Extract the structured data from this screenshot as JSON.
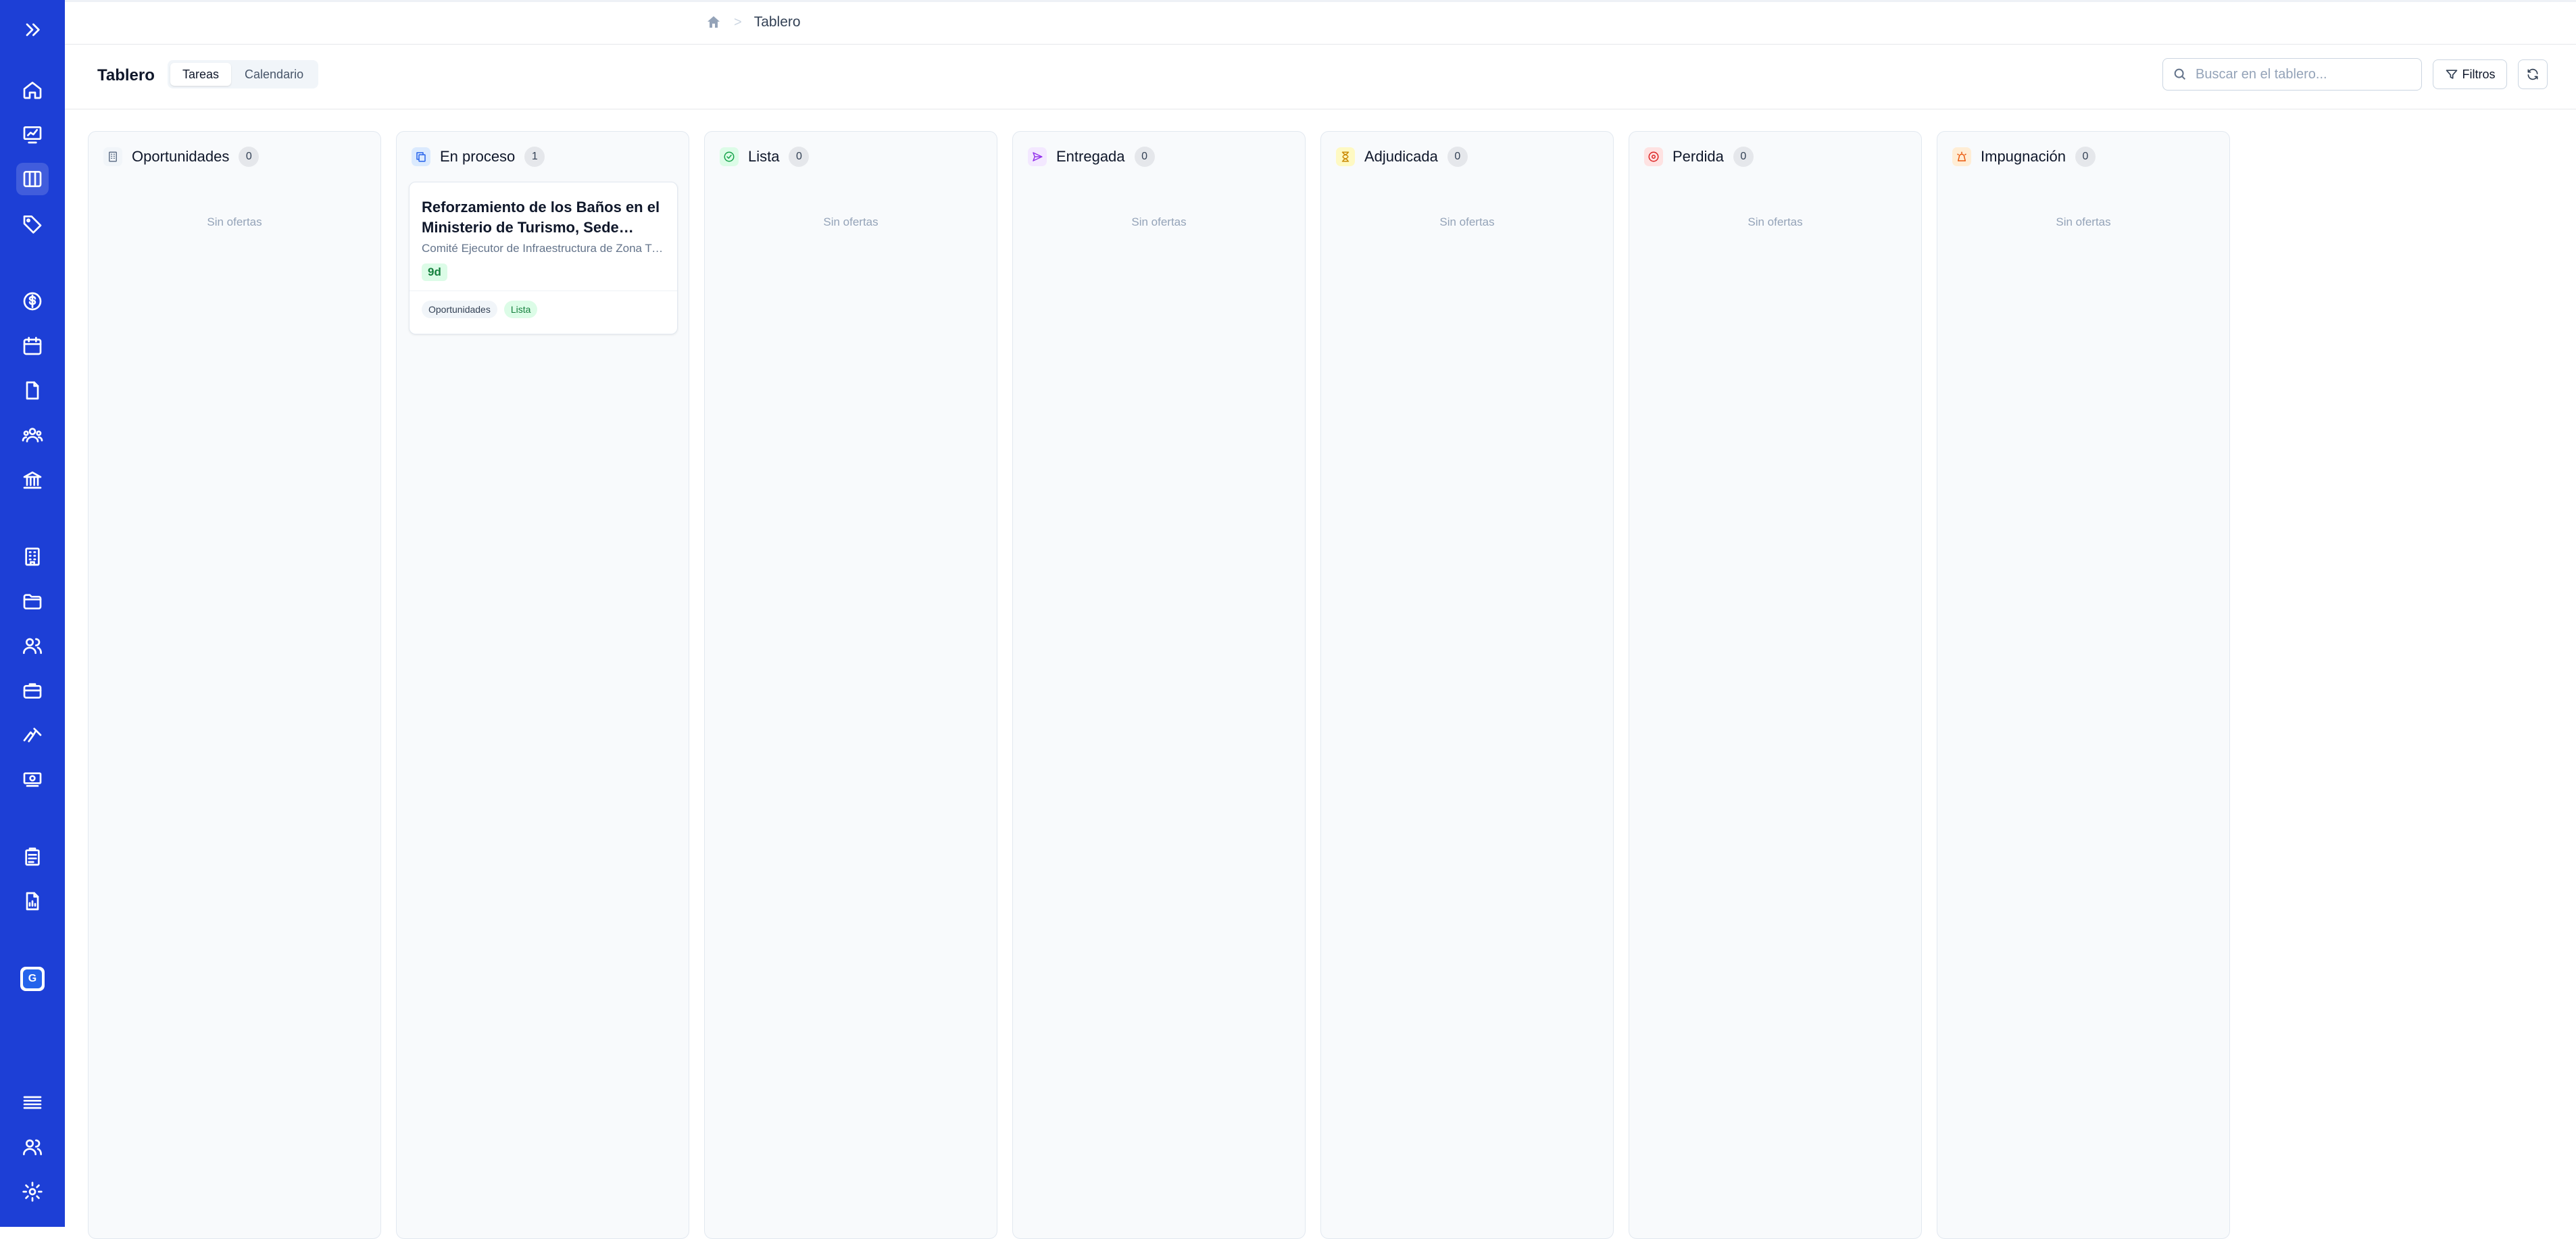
{
  "breadcrumb": {
    "home_icon": "home-icon",
    "current": "Tablero"
  },
  "header": {
    "title": "Tablero",
    "views": [
      "Tareas",
      "Calendario"
    ],
    "selected_view": "Tareas",
    "search_placeholder": "Buscar en el tablero...",
    "filter_label": "Filtros"
  },
  "sidebar": {
    "items": [
      "expand-icon",
      "home-icon",
      "dashboard-icon",
      "board-icon",
      "tag-icon",
      "dollar-icon",
      "calendar-icon",
      "file-icon",
      "team-icon",
      "institution-icon",
      "building-icon",
      "folder-icon",
      "users-icon",
      "briefcase-icon",
      "tools-icon",
      "money-icon",
      "clipboard-icon",
      "report-icon",
      "list-icon",
      "contacts-icon",
      "settings-icon"
    ],
    "active": "board-icon",
    "org_initial": "G"
  },
  "board": {
    "empty_label": "Sin ofertas",
    "columns": [
      {
        "name": "Oportunidades",
        "count": "0",
        "icon": "building-icon",
        "color": "#64748b",
        "bg": "#f1f5f9"
      },
      {
        "name": "En proceso",
        "count": "1",
        "icon": "copy-icon",
        "color": "#2563eb",
        "bg": "#dbeafe"
      },
      {
        "name": "Lista",
        "count": "0",
        "icon": "check-circle-icon",
        "color": "#16a34a",
        "bg": "#dcfce7"
      },
      {
        "name": "Entregada",
        "count": "0",
        "icon": "send-icon",
        "color": "#9333ea",
        "bg": "#f3e8ff"
      },
      {
        "name": "Adjudicada",
        "count": "0",
        "icon": "hourglass-icon",
        "color": "#ca8a04",
        "bg": "#fef9c3"
      },
      {
        "name": "Perdida",
        "count": "0",
        "icon": "x-circle-icon",
        "color": "#dc2626",
        "bg": "#fee2e2"
      },
      {
        "name": "Impugnación",
        "count": "0",
        "icon": "alert-icon",
        "color": "#ea580c",
        "bg": "#ffedd5"
      }
    ],
    "card": {
      "title": "Reforzamiento de los Baños en el Ministerio de Turismo, Sede Principal",
      "subtitle": "Comité Ejecutor de Infraestructura de Zona Turística",
      "due": "9d",
      "tags": [
        "Oportunidades",
        "Lista"
      ]
    }
  }
}
